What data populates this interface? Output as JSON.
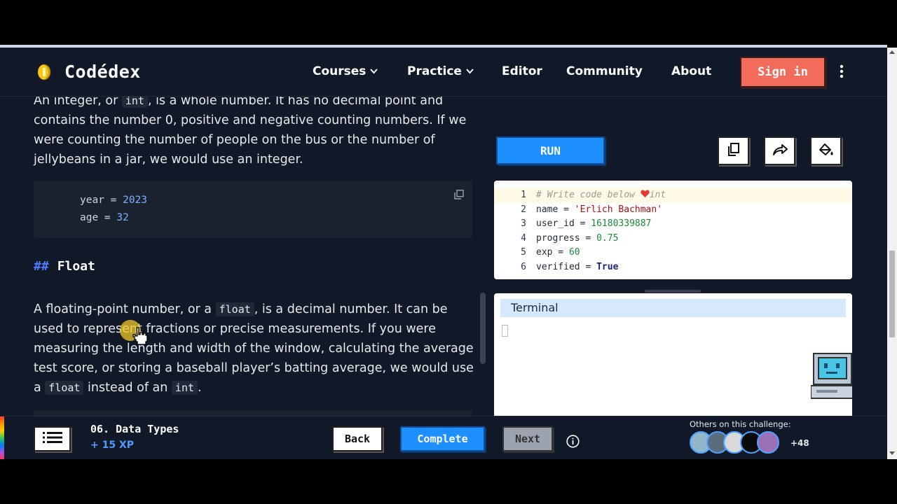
{
  "app": {
    "brand": "Codédex"
  },
  "nav": {
    "courses": "Courses",
    "practice": "Practice",
    "editor": "Editor",
    "community": "Community",
    "about": "About",
    "sign_in": "Sign in"
  },
  "lesson": {
    "int_para": {
      "p1": "An integer, or ",
      "code1": "int",
      "p2": ", is a whole number. It has no decimal point and contains the number 0, positive and negative counting numbers. If we were counting the number of people on the bus or the number of jellybeans in a jar, we would use an integer."
    },
    "int_code": {
      "line1_var": "year = ",
      "line1_val": "2023",
      "line2_var": "age = ",
      "line2_val": "32"
    },
    "float_heading": {
      "hash": "##",
      "text": "Float"
    },
    "float_para": {
      "p1": "A floating-point number, or a ",
      "code1": "float",
      "p2": ", is a decimal number. It can be used to represent fractions or precise measurements. If you were measuring the length and width of the window, calculating the average test score, or storing a baseball player’s batting average, we would use a ",
      "code2": "float",
      "p3": " instead of an ",
      "code3": "int",
      "p4": "."
    }
  },
  "editor": {
    "run_label": "RUN",
    "lines": {
      "l1": {
        "num": "1",
        "comment": "# Write code below ",
        "after": "int"
      },
      "l2": {
        "num": "2",
        "var": "name = ",
        "val": "'Erlich Bachman'"
      },
      "l3": {
        "num": "3",
        "var": "user_id = ",
        "val": "16180339887"
      },
      "l4": {
        "num": "4",
        "var": "progress = ",
        "val": "0.75"
      },
      "l5": {
        "num": "5",
        "var": "exp = ",
        "val": "60"
      },
      "l6": {
        "num": "6",
        "var": "verified = ",
        "val": "True"
      }
    },
    "terminal_title": "Terminal"
  },
  "footer": {
    "lesson_title": "06. Data Types",
    "xp": "+ 15 XP",
    "back": "Back",
    "complete": "Complete",
    "next": "Next",
    "others_label": "Others on this challenge:",
    "others_count": "+48"
  },
  "colors": {
    "background": "#111827",
    "accent_blue": "#1e8fff",
    "sign_in_red": "#f26b5b",
    "heading_hash": "#4f7cff"
  }
}
